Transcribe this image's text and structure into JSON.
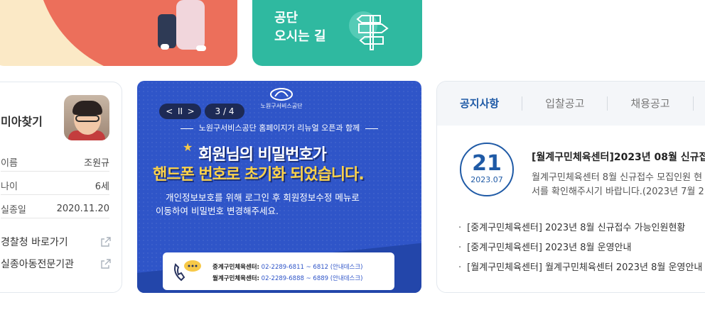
{
  "top": {
    "directions_line1": "공단",
    "directions_line2": "오시는 길"
  },
  "missing_child": {
    "title": "미아찾기",
    "rows": [
      {
        "key": "이름",
        "value": "조원규"
      },
      {
        "key": "나이",
        "value": "6세"
      },
      {
        "key": "실종일",
        "value": "2020.11.20"
      }
    ],
    "links": [
      {
        "label": "경찰청 바로가기"
      },
      {
        "label": "실종아동전문기관"
      }
    ]
  },
  "banner": {
    "ctrl_prev": "<",
    "ctrl_pause": "II",
    "ctrl_next": ">",
    "page": "3 / 4",
    "logo_text": "노원구서비스공단",
    "subtitle": "노원구서비스공단 홈페이지가 리뉴얼 오픈과 함께",
    "headline1": "회원님의 비밀번호가",
    "headline2": "핸드폰 번호로 초기화 되었습니다.",
    "desc_line1": "개인정보보호를 위해 로그인 후 회원정보수정 메뉴로",
    "desc_line2": "이동하여 비밀번호 변경해주세요.",
    "contact1_label": "중계구민체육센터:",
    "contact1_num": "02-2289-6811 ~ 6812 (안내데스크)",
    "contact2_label": "월계구민체육센터:",
    "contact2_num": "02-2289-6888 ~ 6889 (안내데스크)"
  },
  "notice": {
    "tabs": [
      "공지사항",
      "입찰공고",
      "채용공고"
    ],
    "featured": {
      "day": "21",
      "year_month": "2023.07",
      "title": "[월계구민체육센터]2023년 08월 신규접",
      "desc_line1": "월계구민체육센터 8월 신규접수 모집인원 현",
      "desc_line2": "서를 확인해주시기 바랍니다.(2023년 7월 2"
    },
    "items": [
      "[중계구민체육센터] 2023년 8월 신규접수 가능인원현황",
      "[중계구민체육센터] 2023년 8월 운영안내",
      "[월계구민체육센터] 월계구민체육센터 2023년 8월 운영안내"
    ]
  },
  "colors": {
    "green_card": "#2fb9a0",
    "banner_blue": "#2f55c8",
    "notice_blue": "#1f5aa6",
    "headline_yellow": "#fcd24a"
  }
}
